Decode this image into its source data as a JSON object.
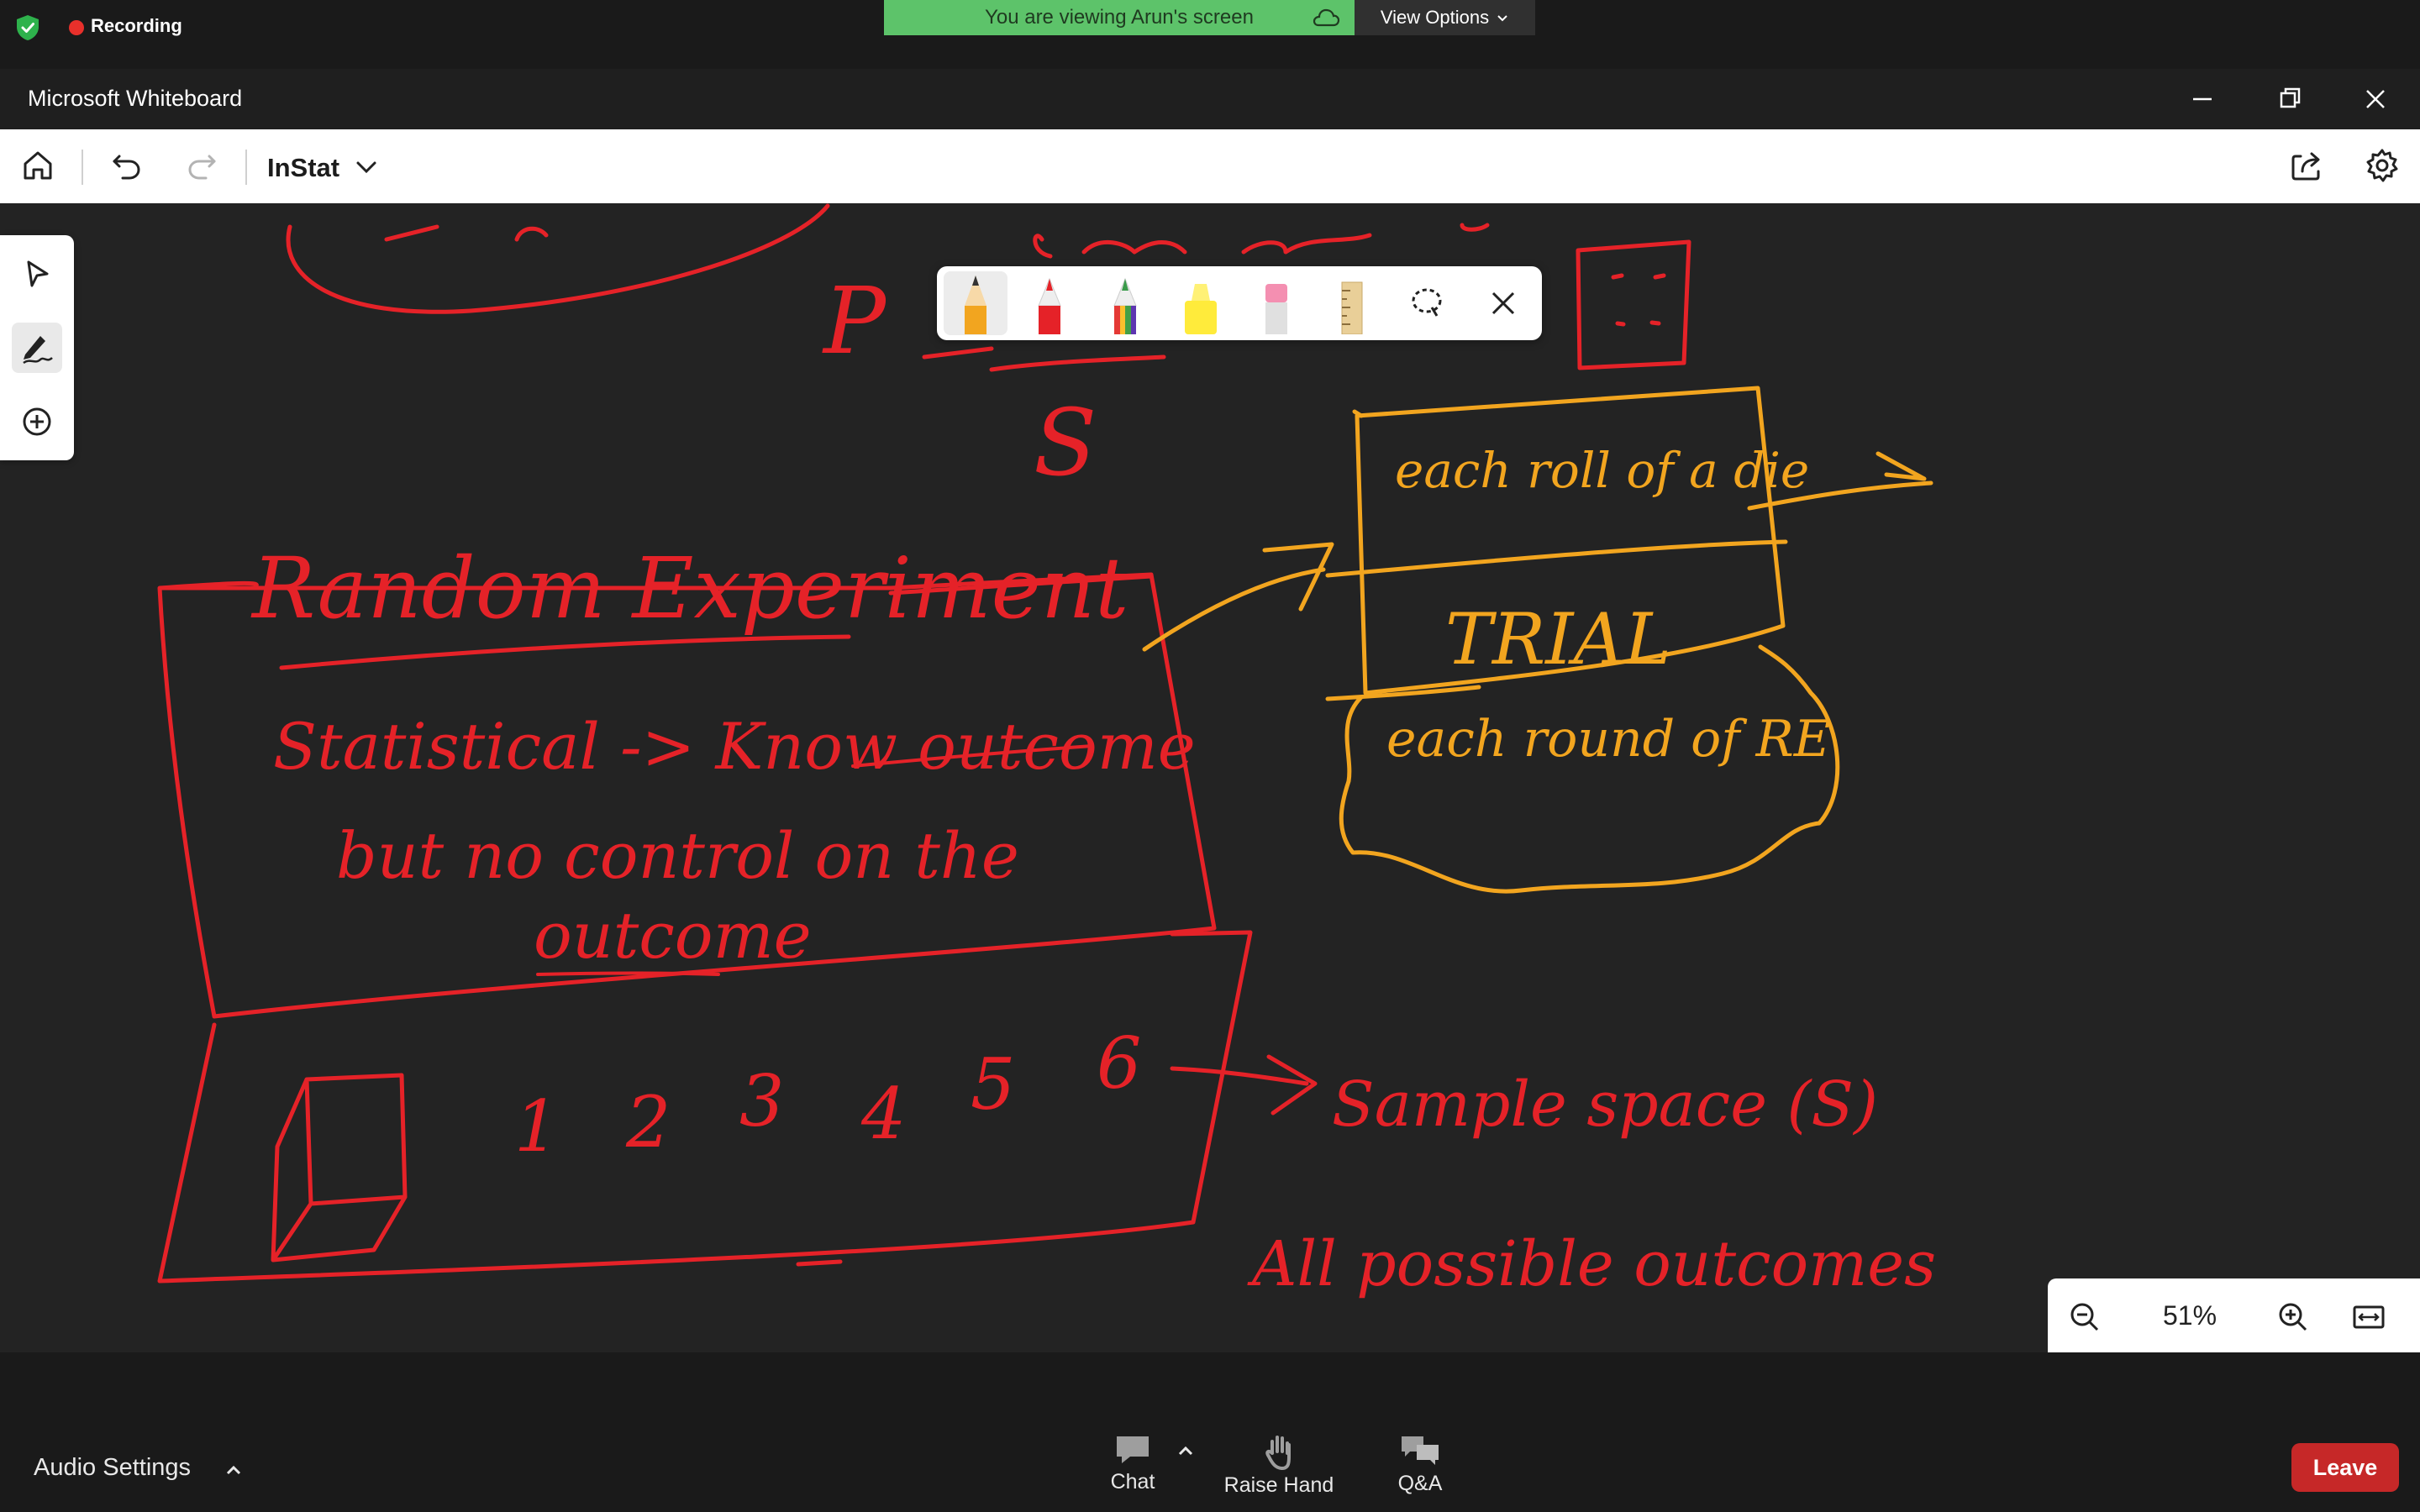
{
  "zoom_bar": {
    "recording_label": "Recording",
    "viewing_banner": "You are viewing Arun's screen",
    "view_options_label": "View Options"
  },
  "window": {
    "title": "Microsoft Whiteboard"
  },
  "toolbar": {
    "board_name": "InStat"
  },
  "zoom": {
    "level": "51%"
  },
  "meeting_bar": {
    "audio_settings_label": "Audio Settings",
    "chat_label": "Chat",
    "raise_hand_label": "Raise Hand",
    "qa_label": "Q&A",
    "leave_label": "Leave"
  },
  "ink": {
    "title": "Random Experiment",
    "line1": "Statistical -> Know outcome",
    "line2": "but no control on the",
    "line3": "outcome",
    "numbers": [
      "1",
      "2",
      "3",
      "4",
      "5",
      "6"
    ],
    "sample_space": "Sample space (S)",
    "all_outcomes": "All possible outcomes",
    "roll_note": "each roll of a die",
    "trial": "TRIAL",
    "round_note": "each round of RE",
    "p_letter": "P",
    "s_letter": "S",
    "colors": {
      "red": "#e52228",
      "orange": "#f2a51f"
    }
  }
}
